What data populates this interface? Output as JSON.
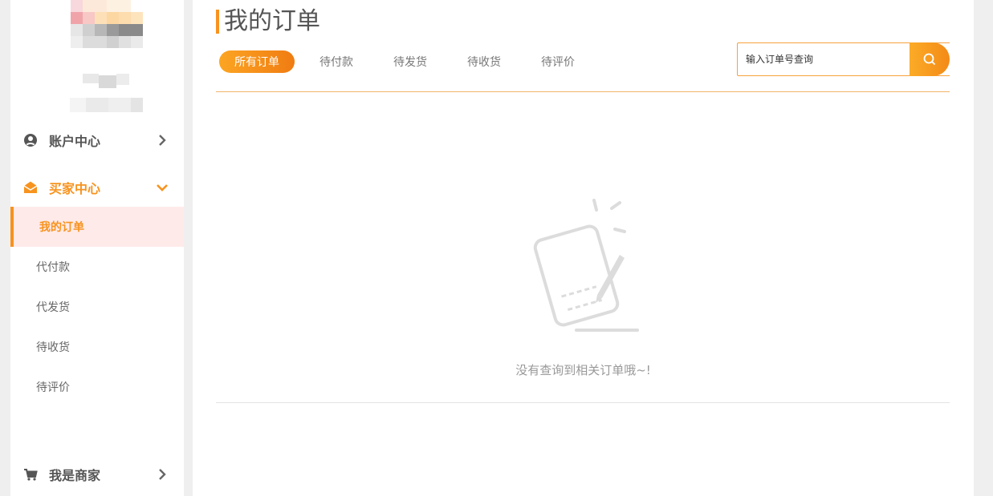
{
  "sidebar": {
    "account_center": {
      "label": "账户中心",
      "icon": "user-circle-icon"
    },
    "buyer_center": {
      "label": "买家中心",
      "icon": "envelope-open-icon"
    },
    "buyer_items": [
      {
        "label": "我的订单",
        "active": true
      },
      {
        "label": "代付款"
      },
      {
        "label": "代发货"
      },
      {
        "label": "待收货"
      },
      {
        "label": "待评价"
      }
    ],
    "merchant": {
      "label": "我是商家",
      "icon": "cart-icon"
    }
  },
  "main": {
    "title": "我的订单",
    "tabs": [
      {
        "label": "所有订单",
        "active": true
      },
      {
        "label": "待付款"
      },
      {
        "label": "待发货"
      },
      {
        "label": "待收货"
      },
      {
        "label": "待评价"
      }
    ],
    "search": {
      "placeholder": "输入订单号查询",
      "icon": "search-icon"
    },
    "empty_message": "没有查询到相关订单哦~!"
  },
  "colors": {
    "accent": "#f7931e",
    "active_item_bg": "#ffeaea",
    "text": "#555555",
    "muted_text": "#999999"
  }
}
